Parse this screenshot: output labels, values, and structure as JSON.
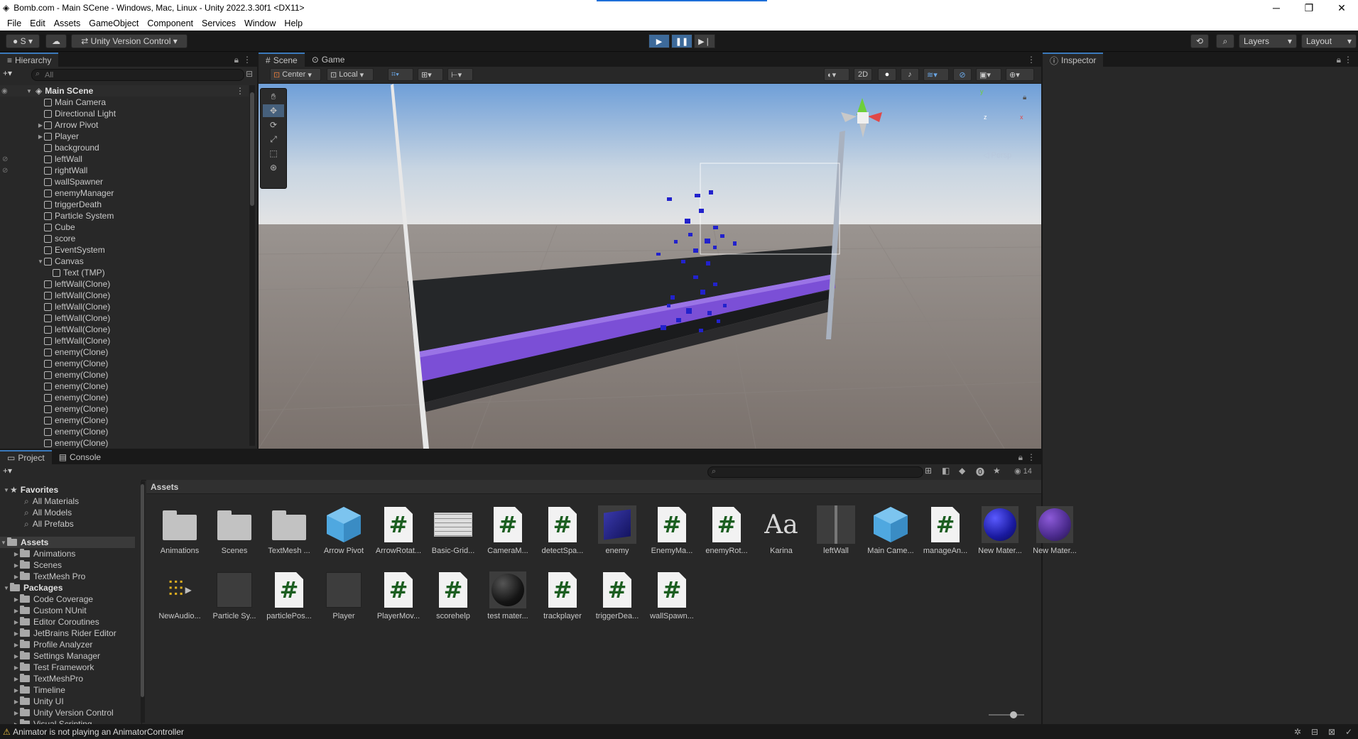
{
  "window": {
    "title": "Bomb.com - Main SCene - Windows, Mac, Linux - Unity 2022.3.30f1 <DX11>",
    "min": "─",
    "max": "❐",
    "close": "✕"
  },
  "menu": [
    "File",
    "Edit",
    "Assets",
    "GameObject",
    "Component",
    "Services",
    "Window",
    "Help"
  ],
  "toolbar": {
    "account": "S",
    "version_control": "Unity Version Control",
    "layers": "Layers",
    "layout": "Layout"
  },
  "hierarchy": {
    "tab": "Hierarchy",
    "search_placeholder": "All",
    "scene": "Main SCene",
    "items": [
      {
        "label": "Main Camera",
        "indent": 1,
        "arrow": false
      },
      {
        "label": "Directional Light",
        "indent": 1,
        "arrow": false
      },
      {
        "label": "Arrow Pivot",
        "indent": 1,
        "arrow": true
      },
      {
        "label": "Player",
        "indent": 1,
        "arrow": true
      },
      {
        "label": "background",
        "indent": 1,
        "arrow": false
      },
      {
        "label": "leftWall",
        "indent": 1,
        "arrow": false
      },
      {
        "label": "rightWall",
        "indent": 1,
        "arrow": false
      },
      {
        "label": "wallSpawner",
        "indent": 1,
        "arrow": false
      },
      {
        "label": "enemyManager",
        "indent": 1,
        "arrow": false
      },
      {
        "label": "triggerDeath",
        "indent": 1,
        "arrow": false
      },
      {
        "label": "Particle System",
        "indent": 1,
        "arrow": false
      },
      {
        "label": "Cube",
        "indent": 1,
        "arrow": false
      },
      {
        "label": "score",
        "indent": 1,
        "arrow": false
      },
      {
        "label": "EventSystem",
        "indent": 1,
        "arrow": false
      },
      {
        "label": "Canvas",
        "indent": 1,
        "arrow": true
      },
      {
        "label": "Text (TMP)",
        "indent": 2,
        "arrow": false
      },
      {
        "label": "leftWall(Clone)",
        "indent": 1,
        "arrow": false
      },
      {
        "label": "leftWall(Clone)",
        "indent": 1,
        "arrow": false
      },
      {
        "label": "leftWall(Clone)",
        "indent": 1,
        "arrow": false
      },
      {
        "label": "leftWall(Clone)",
        "indent": 1,
        "arrow": false
      },
      {
        "label": "leftWall(Clone)",
        "indent": 1,
        "arrow": false
      },
      {
        "label": "leftWall(Clone)",
        "indent": 1,
        "arrow": false
      },
      {
        "label": "enemy(Clone)",
        "indent": 1,
        "arrow": false
      },
      {
        "label": "enemy(Clone)",
        "indent": 1,
        "arrow": false
      },
      {
        "label": "enemy(Clone)",
        "indent": 1,
        "arrow": false
      },
      {
        "label": "enemy(Clone)",
        "indent": 1,
        "arrow": false
      },
      {
        "label": "enemy(Clone)",
        "indent": 1,
        "arrow": false
      },
      {
        "label": "enemy(Clone)",
        "indent": 1,
        "arrow": false
      },
      {
        "label": "enemy(Clone)",
        "indent": 1,
        "arrow": false
      },
      {
        "label": "enemy(Clone)",
        "indent": 1,
        "arrow": false
      },
      {
        "label": "enemy(Clone)",
        "indent": 1,
        "arrow": false
      }
    ]
  },
  "scene": {
    "tabs": [
      "Scene",
      "Game"
    ],
    "pivot": "Center",
    "space": "Local",
    "mode2d": "2D",
    "persp": "◁ Persp",
    "gizmo_axes": [
      "y",
      "x",
      "z"
    ]
  },
  "inspector": {
    "tab": "Inspector"
  },
  "project": {
    "tabs": [
      "Project",
      "Console"
    ],
    "favorites_label": "Favorites",
    "favorites": [
      "All Materials",
      "All Models",
      "All Prefabs"
    ],
    "assets_label": "Assets",
    "asset_folders": [
      "Animations",
      "Scenes",
      "TextMesh Pro"
    ],
    "packages_label": "Packages",
    "packages": [
      "Code Coverage",
      "Custom NUnit",
      "Editor Coroutines",
      "JetBrains Rider Editor",
      "Profile Analyzer",
      "Settings Manager",
      "Test Framework",
      "TextMeshPro",
      "Timeline",
      "Unity UI",
      "Unity Version Control",
      "Visual Scripting"
    ],
    "breadcrumb": "Assets",
    "hidden_count": "14",
    "grid": [
      {
        "label": "Animations",
        "kind": "folder"
      },
      {
        "label": "Scenes",
        "kind": "folder"
      },
      {
        "label": "TextMesh ...",
        "kind": "folder"
      },
      {
        "label": "Arrow Pivot",
        "kind": "prefab"
      },
      {
        "label": "ArrowRotat...",
        "kind": "script"
      },
      {
        "label": "Basic-Grid...",
        "kind": "grid"
      },
      {
        "label": "CameraM...",
        "kind": "script"
      },
      {
        "label": "detectSpa...",
        "kind": "script"
      },
      {
        "label": "enemy",
        "kind": "enemy"
      },
      {
        "label": "EnemyMa...",
        "kind": "script"
      },
      {
        "label": "enemyRot...",
        "kind": "script"
      },
      {
        "label": "Karina",
        "kind": "font"
      },
      {
        "label": "leftWall",
        "kind": "wall"
      },
      {
        "label": "Main Came...",
        "kind": "prefab"
      },
      {
        "label": "manageAn...",
        "kind": "script"
      },
      {
        "label": "New Mater...",
        "kind": "bluesphere"
      },
      {
        "label": "New Mater...",
        "kind": "purplesphere"
      },
      {
        "label": "NewAudio...",
        "kind": "audio"
      },
      {
        "label": "Particle Sy...",
        "kind": "gray"
      },
      {
        "label": "particlePos...",
        "kind": "script"
      },
      {
        "label": "Player",
        "kind": "gray"
      },
      {
        "label": "PlayerMov...",
        "kind": "script"
      },
      {
        "label": "scorehelp",
        "kind": "script"
      },
      {
        "label": "test mater...",
        "kind": "blacksphere"
      },
      {
        "label": "trackplayer",
        "kind": "script"
      },
      {
        "label": "triggerDea...",
        "kind": "script"
      },
      {
        "label": "wallSpawn...",
        "kind": "script"
      }
    ]
  },
  "status": {
    "message": "Animator is not playing an AnimatorController"
  },
  "colors": {
    "accent": "#3a79bb",
    "panel": "#282828",
    "dark": "#191919",
    "warning": "#f0c040",
    "purple": "#7b4fd6"
  }
}
